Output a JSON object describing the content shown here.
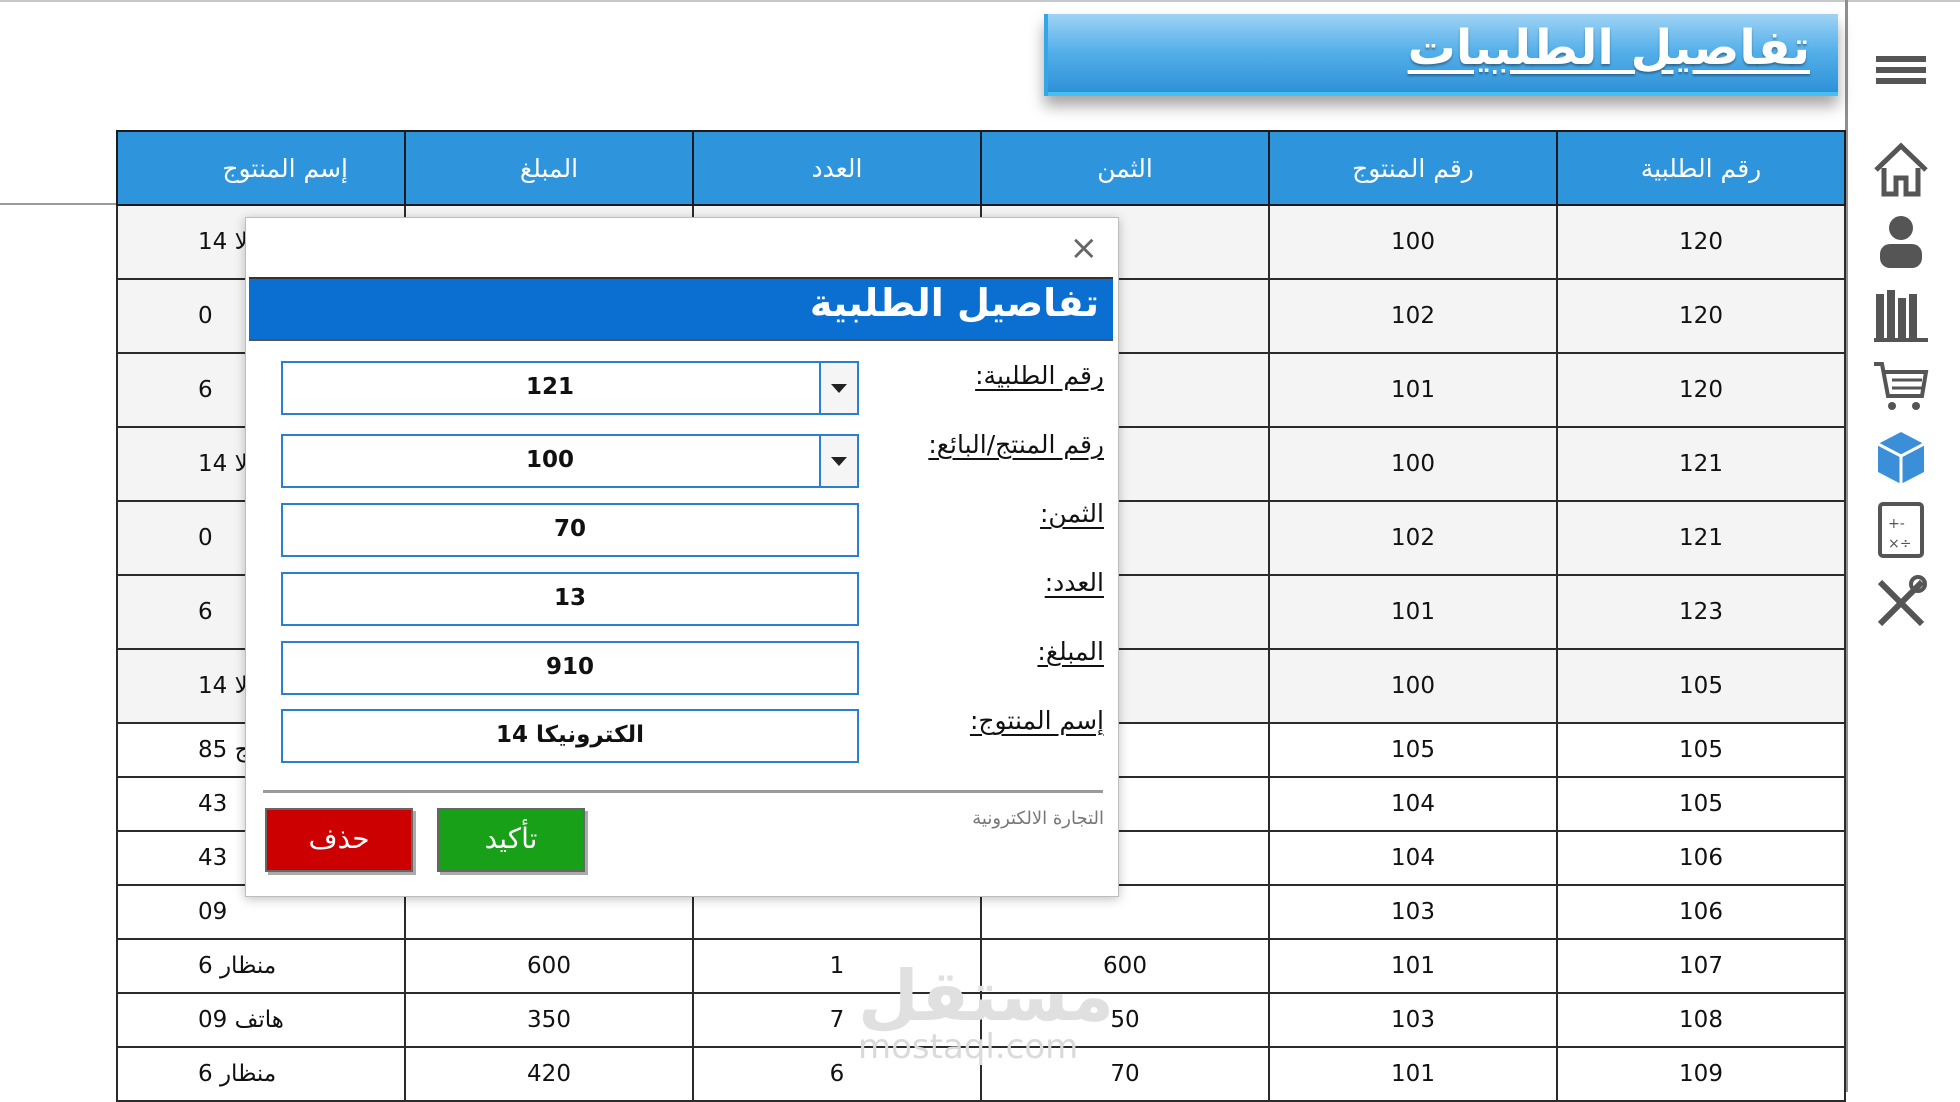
{
  "page_title": "تفاصيل الطلبيات",
  "table": {
    "headers": [
      "رقم الطلبية",
      "رقم المنتوج",
      "الثمن",
      "العدد",
      "المبلغ",
      "إسم المنتوج"
    ],
    "rows": [
      [
        "120",
        "100",
        "",
        "",
        "",
        "لا 14"
      ],
      [
        "120",
        "102",
        "",
        "",
        "",
        "0"
      ],
      [
        "120",
        "101",
        "",
        "",
        "",
        "6"
      ],
      [
        "121",
        "100",
        "",
        "",
        "",
        "لا 14"
      ],
      [
        "121",
        "102",
        "",
        "",
        "",
        "0"
      ],
      [
        "123",
        "101",
        "",
        "",
        "",
        "6"
      ],
      [
        "105",
        "100",
        "",
        "",
        "",
        "لا 14"
      ],
      [
        "105",
        "105",
        "",
        "",
        "",
        "ياج 85"
      ],
      [
        "105",
        "104",
        "",
        "",
        "",
        "43"
      ],
      [
        "106",
        "104",
        "",
        "",
        "",
        "43"
      ],
      [
        "106",
        "103",
        "",
        "",
        "",
        "09"
      ],
      [
        "107",
        "101",
        "600",
        "1",
        "600",
        "منظار 6"
      ],
      [
        "108",
        "103",
        "50",
        "7",
        "350",
        "هاتف 09"
      ],
      [
        "109",
        "101",
        "70",
        "6",
        "420",
        "منظار 6"
      ]
    ]
  },
  "watermark": {
    "arabic": "مستقل",
    "latin": "mostaql.com"
  },
  "sidebar": {
    "items": [
      "menu-icon",
      "home-icon",
      "user-icon",
      "books-icon",
      "cart-icon",
      "box-icon",
      "calculator-icon",
      "tools-icon"
    ]
  },
  "dialog": {
    "close_glyph": "×",
    "title": "تفاصيل الطلبية",
    "fields": {
      "order_no": {
        "label": "رقم الطلبية:",
        "value": "121"
      },
      "product_seller": {
        "label": "رقم المنتج/البائع:",
        "value": "100"
      },
      "price": {
        "label": "الثمن:",
        "value": "70"
      },
      "quantity": {
        "label": "العدد:",
        "value": "13"
      },
      "amount": {
        "label": "المبلغ:",
        "value": "910"
      },
      "product_name": {
        "label": "إسم المنتوج:",
        "value": "الكترونيكا 14"
      }
    },
    "footer_text": "التجارة الالكترونية",
    "confirm_label": "تأكيد",
    "delete_label": "حذف"
  },
  "colors": {
    "header_blue": "#2e95dc",
    "dialog_header": "#0a6fd0",
    "confirm_green": "#18a018",
    "delete_red": "#cc0000"
  }
}
